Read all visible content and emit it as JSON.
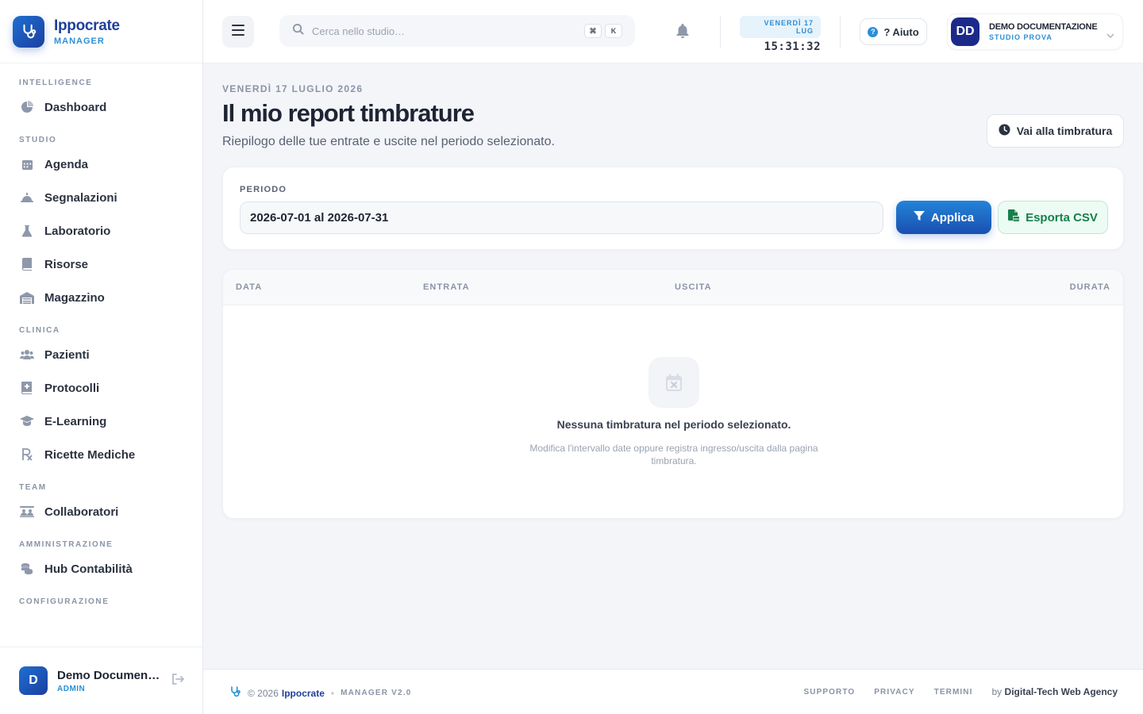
{
  "brand": {
    "name": "Ippocrate",
    "sub": "MANAGER"
  },
  "sidebar": {
    "sections": [
      {
        "title": "INTELLIGENCE",
        "items": [
          {
            "label": "Dashboard",
            "icon": "pie-chart-icon"
          }
        ]
      },
      {
        "title": "STUDIO",
        "items": [
          {
            "label": "Agenda",
            "icon": "calendar-icon"
          },
          {
            "label": "Segnalazioni",
            "icon": "bell-alert-icon"
          },
          {
            "label": "Laboratorio",
            "icon": "flask-icon"
          },
          {
            "label": "Risorse",
            "icon": "book-icon"
          },
          {
            "label": "Magazzino",
            "icon": "warehouse-icon"
          }
        ]
      },
      {
        "title": "CLINICA",
        "items": [
          {
            "label": "Pazienti",
            "icon": "users-icon"
          },
          {
            "label": "Protocolli",
            "icon": "file-medical-icon"
          },
          {
            "label": "E-Learning",
            "icon": "graduation-cap-icon"
          },
          {
            "label": "Ricette Mediche",
            "icon": "prescription-icon"
          }
        ]
      },
      {
        "title": "TEAM",
        "items": [
          {
            "label": "Collaboratori",
            "icon": "team-icon"
          }
        ]
      },
      {
        "title": "AMMINISTRAZIONE",
        "items": [
          {
            "label": "Hub Contabilità",
            "icon": "coins-icon"
          }
        ]
      },
      {
        "title": "CONFIGURAZIONE",
        "items": []
      }
    ],
    "user": {
      "initial": "D",
      "name": "Demo Documentazione",
      "role": "ADMIN"
    }
  },
  "topbar": {
    "search_placeholder": "Cerca nello studio…",
    "kbd": [
      "⌘",
      "K"
    ],
    "date_pill": "VENERDÌ 17 LUG",
    "clock": "15:31:32",
    "help_label": "? Aiuto",
    "user": {
      "initials": "DD",
      "name": "DEMO DOCUMENTAZIONE",
      "studio": "STUDIO PROVA"
    }
  },
  "page": {
    "date_line": "VENERDÌ 17 LUGLIO 2026",
    "title": "Il mio report timbrature",
    "subtitle": "Riepilogo delle tue entrate e uscite nel periodo selezionato.",
    "goto_label": "Vai alla timbratura"
  },
  "filter": {
    "label": "PERIODO",
    "value": "2026-07-01 al 2026-07-31",
    "apply_label": "Applica",
    "export_label": "Esporta CSV"
  },
  "table": {
    "columns": [
      "DATA",
      "ENTRATA",
      "USCITA",
      "DURATA"
    ],
    "rows": [],
    "empty_title": "Nessuna timbratura nel periodo selezionato.",
    "empty_sub": "Modifica l'intervallo date oppure registra ingresso/uscita dalla pagina timbratura."
  },
  "footer": {
    "copyright": "© 2026",
    "brand": "Ippocrate",
    "version": "MANAGER V2.0",
    "links": [
      "SUPPORTO",
      "PRIVACY",
      "TERMINI"
    ],
    "by_prefix": "by",
    "by_name": "Digital-Tech Web Agency"
  },
  "colors": {
    "primary": "#1f3f9a",
    "accent": "#2a8fd6",
    "success": "#17804a"
  }
}
